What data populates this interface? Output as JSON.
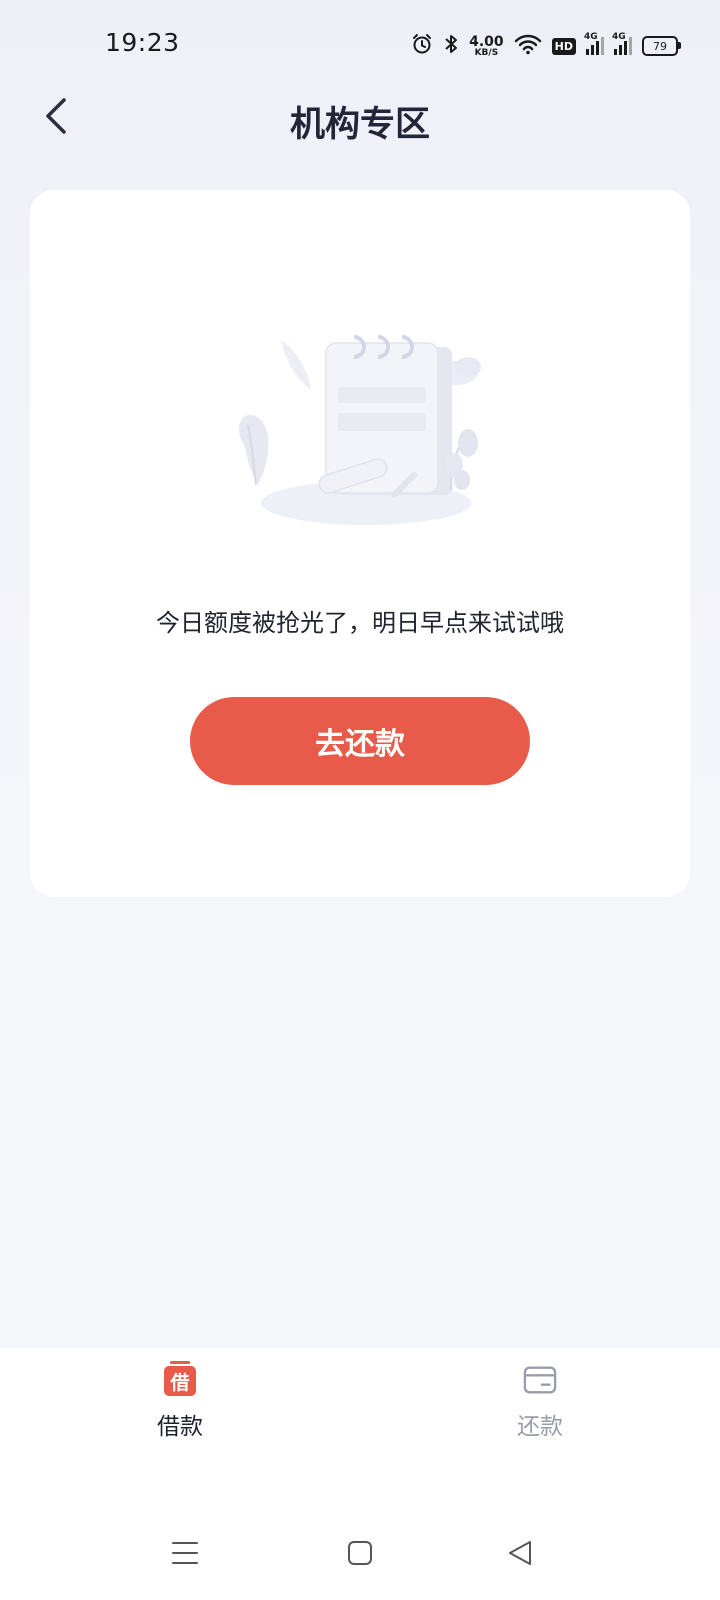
{
  "status_bar": {
    "time": "19:23",
    "net_speed_value": "4.00",
    "net_speed_unit": "KB/S",
    "hd_label": "HD",
    "signal1_label": "4G",
    "signal2_label": "4G",
    "battery_level": "79",
    "icons": [
      "alarm-icon",
      "bluetooth-icon",
      "wifi-icon"
    ]
  },
  "header": {
    "title": "机构专区"
  },
  "main": {
    "empty_message": "今日额度被抢光了，明日早点来试试哦",
    "repay_button_label": "去还款"
  },
  "tab_bar": {
    "items": [
      {
        "label": "借款",
        "icon_text": "借",
        "icon": "borrow-icon",
        "active": true
      },
      {
        "label": "还款",
        "icon": "card-icon",
        "active": false
      }
    ]
  },
  "colors": {
    "accent": "#e85a4a",
    "title_text": "#232638",
    "inactive_tab": "#9a9caa",
    "background": "#f5f6fa"
  }
}
